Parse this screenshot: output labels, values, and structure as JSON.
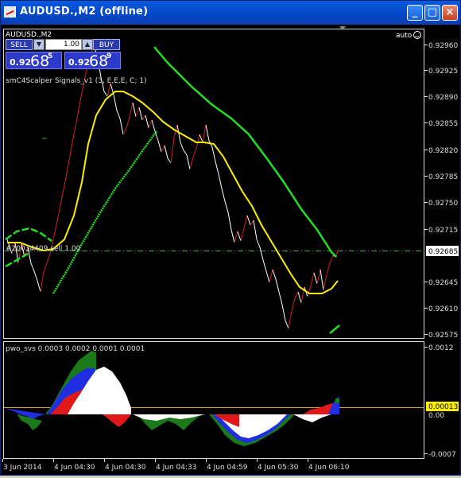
{
  "window": {
    "title": "AUDUSD.,M2 (offline)",
    "buttons": {
      "minimize": "_",
      "maximize": "□",
      "close": "×"
    }
  },
  "chart": {
    "symbol_label": "AUDUSD.,M2",
    "autoscroll_label": "auto",
    "indicator_label": "smC4Scalper Signals_v1 (3, E,E,E, C; 1)",
    "order_label": "#20034409 sell 1.00",
    "current_price": "0.92685",
    "price_ticks": [
      "0.92960",
      "0.92925",
      "0.92890",
      "0.92855",
      "0.92820",
      "0.92785",
      "0.92750",
      "0.92715",
      "0.92645",
      "0.92610",
      "0.92575"
    ],
    "colors": {
      "bull_bar": "#cc2222",
      "bear_bar": "#ffffff",
      "envelope": "#22cc22",
      "ma": "#ffee00",
      "price_line": "#33aa33"
    }
  },
  "trade_panel": {
    "sell_label": "SELL",
    "buy_label": "BUY",
    "lot_value": "1.00",
    "sell_price": {
      "prefix": "0.92",
      "big": "68",
      "sup": "5"
    },
    "buy_price": {
      "prefix": "0.92",
      "big": "68",
      "sup": "9"
    }
  },
  "subwindow": {
    "indicator_label": "pwo_svs 0.0003 0.0002 0.0001 0.0001",
    "ticks": [
      "0.0012",
      "0.00",
      "-0.0007"
    ],
    "current_value": "0.00013"
  },
  "time_axis": [
    "3 Jun 2014",
    "4 Jun 04:30",
    "4 Jun 04:30",
    "4 Jun 04:33",
    "4 Jun 04:59",
    "4 Jun 05:30",
    "4 Jun 06:10"
  ]
}
